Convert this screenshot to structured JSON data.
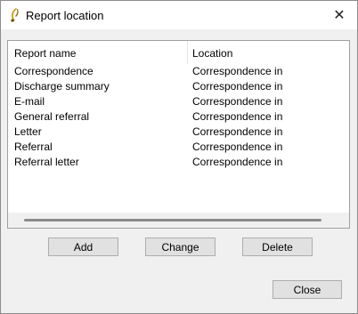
{
  "window": {
    "title": "Report location",
    "close_glyph": "✕"
  },
  "list": {
    "columns": [
      "Report name",
      "Location"
    ],
    "rows": [
      {
        "name": "Correspondence",
        "location": "Correspondence in"
      },
      {
        "name": "Discharge summary",
        "location": "Correspondence in"
      },
      {
        "name": "E-mail",
        "location": "Correspondence in"
      },
      {
        "name": "General referral",
        "location": "Correspondence in"
      },
      {
        "name": "Letter",
        "location": "Correspondence in"
      },
      {
        "name": "Referral",
        "location": "Correspondence in"
      },
      {
        "name": "Referral letter",
        "location": "Correspondence in"
      }
    ]
  },
  "buttons": {
    "add": "Add",
    "change": "Change",
    "delete": "Delete",
    "close": "Close"
  }
}
